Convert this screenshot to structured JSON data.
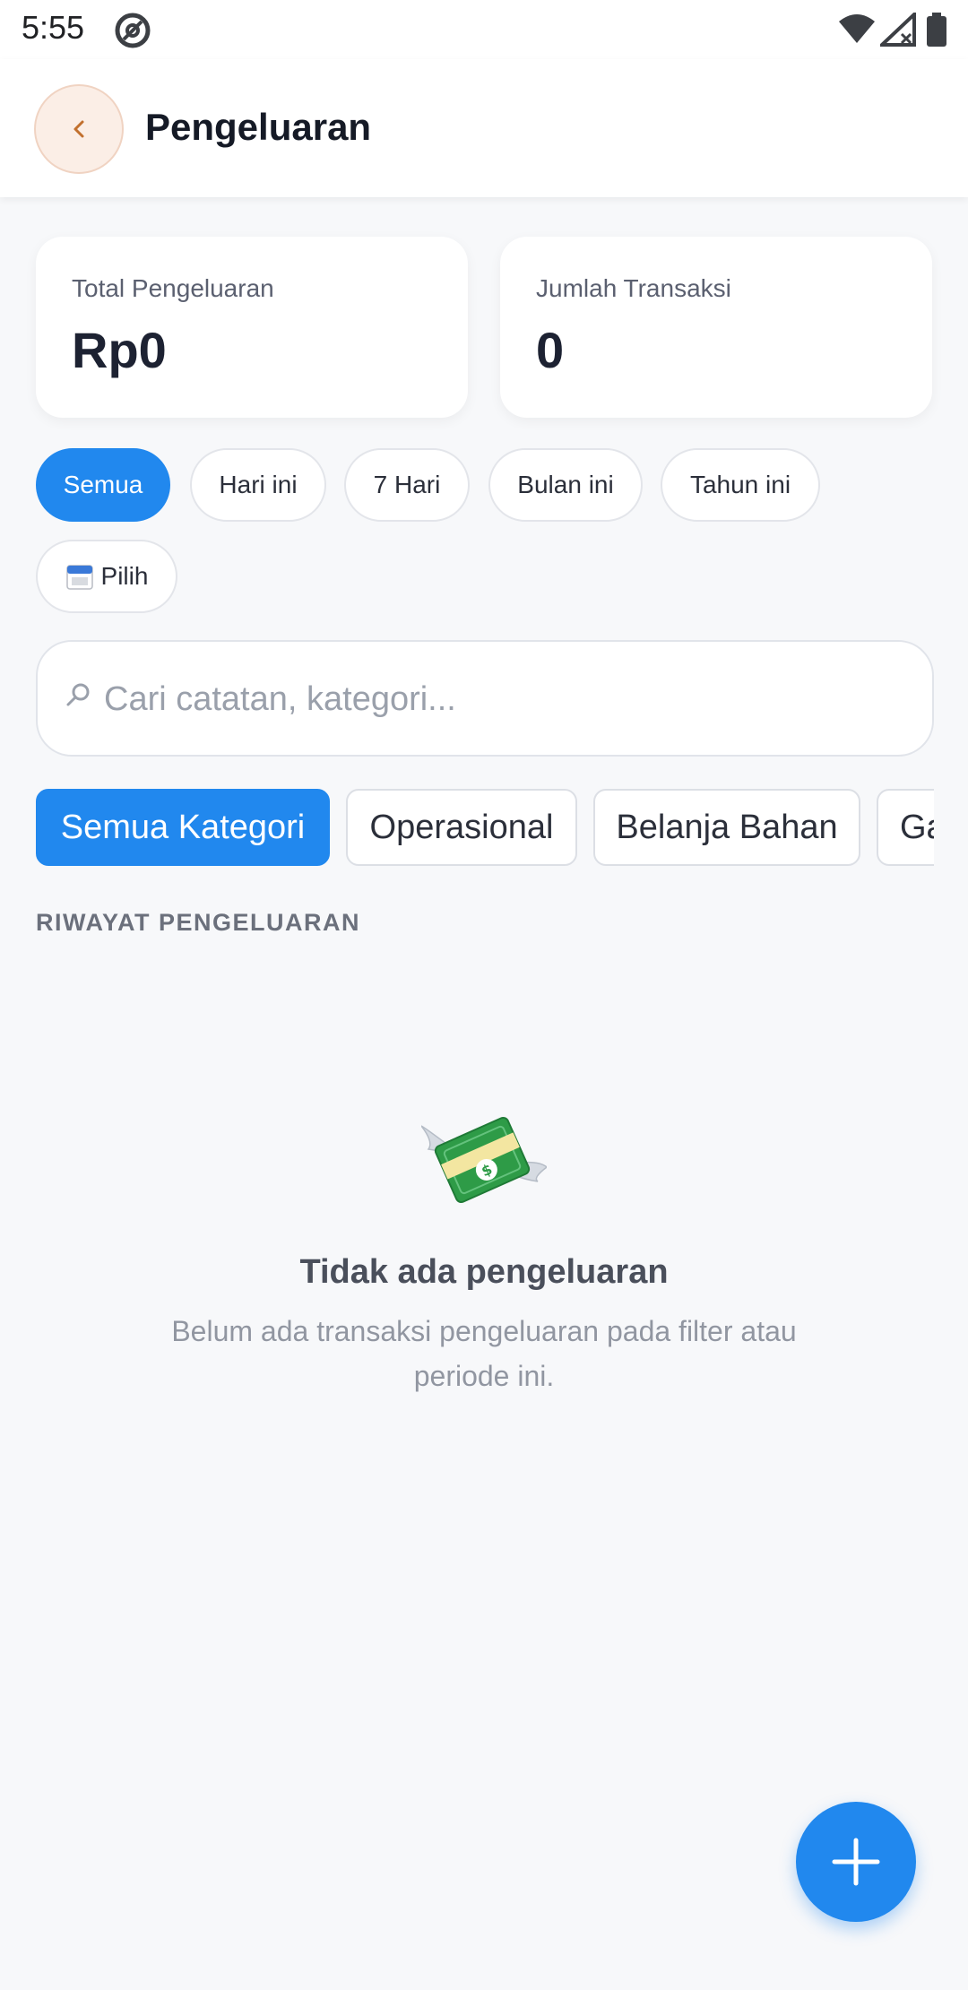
{
  "status_bar": {
    "time": "5:55"
  },
  "header": {
    "back_label": "‹",
    "title": "Pengeluaran"
  },
  "stats": [
    {
      "label": "Total Pengeluaran",
      "value": "Rp0"
    },
    {
      "label": "Jumlah Transaksi",
      "value": "0"
    }
  ],
  "period_filters": {
    "items": [
      "Semua",
      "Hari ini",
      "7 Hari",
      "Bulan ini",
      "Tahun ini",
      "Pilih"
    ],
    "selected": "Semua",
    "custom_icon": "calendar-icon"
  },
  "search": {
    "placeholder": "Cari catatan, kategori...",
    "value": ""
  },
  "category_filters": {
    "items": [
      "Semua Kategori",
      "Operasional",
      "Belanja Bahan",
      "Ga"
    ],
    "selected": "Semua Kategori"
  },
  "section": {
    "title": "RIWAYAT PENGELUARAN"
  },
  "empty_state": {
    "icon": "money-with-wings-icon",
    "title": "Tidak ada pengeluaran",
    "description": "Belum ada transaksi pengeluaran pada filter atau periode ini."
  },
  "fab": {
    "label": "+"
  },
  "colors": {
    "accent": "#2188ee",
    "background": "#f7f8fa",
    "back_button_bg": "#fbeee6"
  }
}
